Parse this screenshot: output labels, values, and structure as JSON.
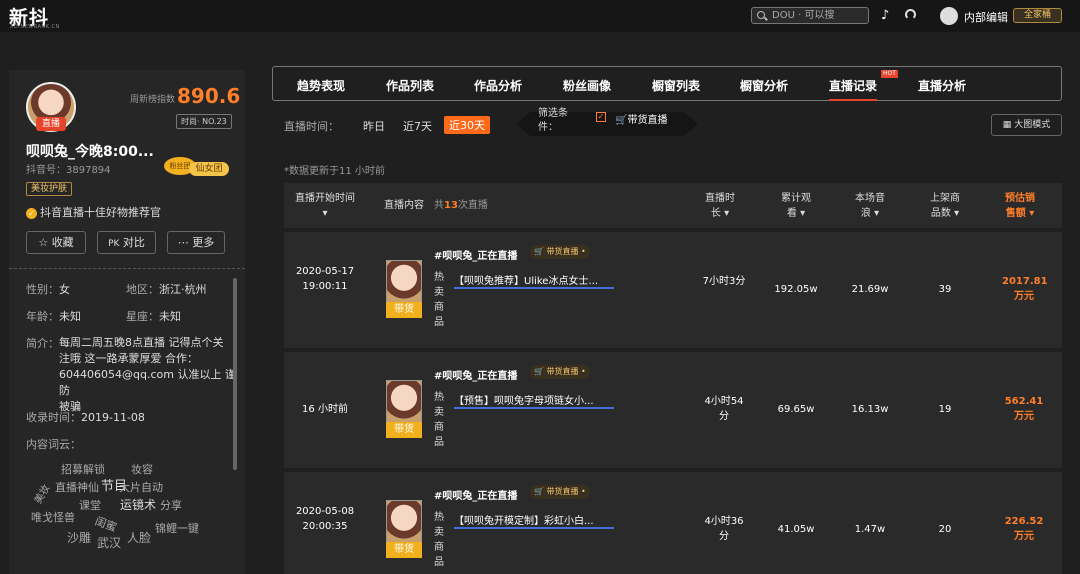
{
  "topbar": {
    "logo": "新抖",
    "logo_sub": "XD.NEWRANK.CN",
    "search_placeholder": "DOU · 可以搜",
    "user": "内部编辑",
    "vip": "全家桶"
  },
  "profile": {
    "live_tag": "直播",
    "index_label": "周新榜指数",
    "index_value": "890.6",
    "rank": "时尚· NO.23",
    "name": "呗呗兔_今晚8:00...",
    "id": "抖音号：3897894",
    "fan_badge": "粉丝团",
    "fan_group": "仙女团",
    "category": "美妆护肤",
    "certification": "抖音直播十佳好物推荐官",
    "buttons": {
      "collect": "收藏",
      "compare": "对比",
      "more": "更多"
    },
    "gender_label": "性别：",
    "gender": "女",
    "region_label": "地区：",
    "region": "浙江·杭州",
    "age_label": "年龄：",
    "age": "未知",
    "zodiac_label": "星座：",
    "zodiac": "未知",
    "bio_label": "简介：",
    "bio_lines": [
      "每周二周五晚8点直播 记得点个关",
      "注哦 这一路承蒙厚爱 合作：",
      "604406054@qq.com 认准以上 谨防",
      "被骗"
    ],
    "included_label": "收录时间：",
    "included": "2019-11-08",
    "wordcloud_label": "内容词云：",
    "wordcloud": [
      "招募解锁",
      "妆容",
      "直播神仙",
      "节目",
      "大片自动",
      "美妆",
      "课堂",
      "运镜术",
      "分享",
      "唯戈怪兽",
      "闺蜜",
      "锦鲤一键",
      "沙雕",
      "武汉",
      "人脸"
    ]
  },
  "tabs": [
    "趋势表现",
    "作品列表",
    "作品分析",
    "粉丝画像",
    "橱窗列表",
    "橱窗分析",
    "直播记录",
    "直播分析"
  ],
  "active_tab": "直播记录",
  "hot_label": "HOT",
  "filter": {
    "label": "直播时间：",
    "days": [
      "昨日",
      "近7天",
      "近30天"
    ],
    "active": "近30天",
    "condition_label": "筛选条件：",
    "condition_value": "带货直播",
    "big_mode": "大图模式"
  },
  "note": "*数据更新于11 小时前",
  "table": {
    "headers": {
      "start": "直播开始时间",
      "content": "直播内容",
      "total_prefix": "共",
      "total_count": "13",
      "total_suffix": "次直播",
      "duration": "直播时长",
      "viewers": "累计观看",
      "likes": "本场音浪",
      "goods": "上架商品数",
      "sales": "预估销售额"
    },
    "rows": [
      {
        "time": "2020-05-17 19:00:11",
        "title": "#呗呗兔_正在直播",
        "badge": "带货直播",
        "thumb_tag": "带货",
        "hot": "热卖商品",
        "product": "【呗呗兔推荐】Ulike冰点女士...",
        "duration": "7小时3分",
        "viewers": "192.05w",
        "likes": "21.69w",
        "goods": "39",
        "sales": "2017.81万元"
      },
      {
        "time": "16 小时前",
        "title": "#呗呗兔_正在直播",
        "badge": "带货直播",
        "thumb_tag": "带货",
        "hot": "热卖商品",
        "product": "【预售】呗呗兔字母项链女小...",
        "duration": "4小时54分",
        "viewers": "69.65w",
        "likes": "16.13w",
        "goods": "19",
        "sales": "562.41万元"
      },
      {
        "time": "2020-05-08 20:00:35",
        "title": "#呗呗兔_正在直播",
        "badge": "带货直播",
        "thumb_tag": "带货",
        "hot": "热卖商品",
        "product": "【呗呗兔开模定制】彩虹小白...",
        "duration": "4小时36分",
        "viewers": "41.05w",
        "likes": "1.47w",
        "goods": "20",
        "sales": "226.52万元"
      }
    ]
  }
}
